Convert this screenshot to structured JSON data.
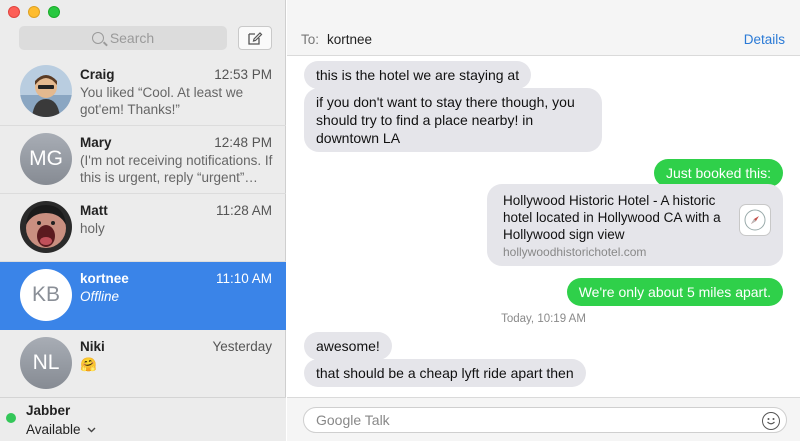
{
  "sidebar": {
    "search_placeholder": "Search",
    "conversations": [
      {
        "name": "Craig",
        "time": "12:53 PM",
        "preview": "You liked “Cool. At least we got'em! Thanks!”",
        "avatar": "photo"
      },
      {
        "name": "Mary",
        "time": "12:48 PM",
        "preview": "(I'm not receiving notifications. If this is urgent, reply “urgent”…",
        "initials": "MG"
      },
      {
        "name": "Matt",
        "time": "11:28 AM",
        "preview": "holy",
        "avatar": "photo"
      },
      {
        "name": "kortnee",
        "time": "11:10 AM",
        "preview": "Offline",
        "initials": "KB",
        "active": true
      },
      {
        "name": "Niki",
        "time": "Yesterday",
        "preview": "🤗",
        "initials": "NL"
      }
    ],
    "status": {
      "account": "Jabber",
      "value": "Available",
      "dot_color": "#34c759"
    }
  },
  "header": {
    "to_label": "To:",
    "recipient": "kortnee",
    "details_label": "Details"
  },
  "messages": {
    "m1": "this is the hotel we are staying at",
    "m2": "if you don't want to stay there though, you should try to find a place nearby! in downtown LA",
    "m3": "Just booked this:",
    "link": {
      "title": "Hollywood Historic Hotel - A historic hotel located in Hollywood CA with a Hollywood sign view",
      "url": "hollywoodhistorichotel.com"
    },
    "m4": "We're only about 5 miles apart.",
    "timestamp": "Today, 10:19 AM",
    "m5": "awesome!",
    "m6": "that should be a cheap lyft ride apart then"
  },
  "composer": {
    "placeholder": "Google Talk"
  },
  "colors": {
    "accent": "#3a84e8",
    "sent_bubble": "#2fd04a",
    "received_bubble": "#e5e5ea"
  }
}
